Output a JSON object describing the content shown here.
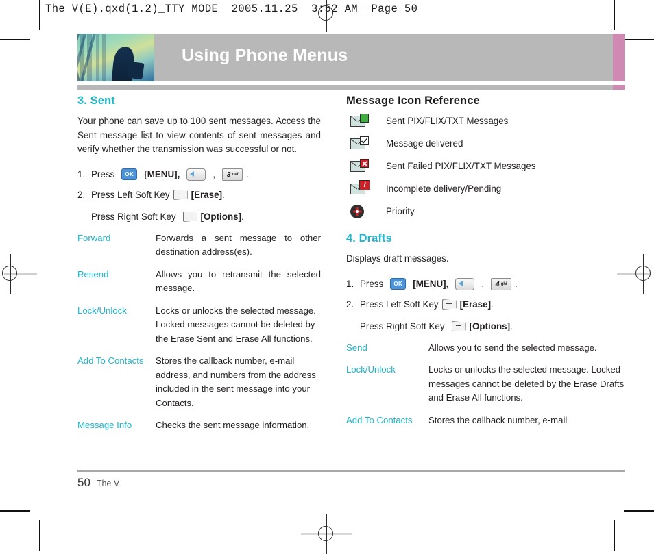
{
  "print_marks": {
    "slug": "The V(E).qxd(1.2)_TTY MODE  2005.11.25  3:52 AM  Page 50"
  },
  "banner": {
    "title": "Using Phone Menus",
    "bar_color": "#b8b8b8",
    "accent_color": "#d089b2"
  },
  "colors": {
    "heading_teal": "#1fb6cd",
    "body_black": "#231f20"
  },
  "left_column": {
    "section": {
      "heading": "3. Sent",
      "intro": "Your phone can save up to 100 sent messages. Access the Sent message list to view contents of sent messages and verify whether the transmission was successful or not."
    },
    "steps": [
      {
        "num": "1.",
        "press_label": "Press",
        "ok_key": "OK",
        "menu_label": "[MENU],",
        "comma": ",",
        "num_key_digit": "3",
        "num_key_letters": "def",
        "period": "."
      },
      {
        "num": "2.",
        "press_label": "Press Left Soft Key",
        "action_label": "[Erase]",
        "period": "."
      }
    ],
    "substep": {
      "press_label": "Press Right Soft Key",
      "action_label": "[Options]",
      "period": "."
    },
    "options": [
      {
        "term": "Forward",
        "desc": "Forwards a sent message to other destination address(es)."
      },
      {
        "term": "Resend",
        "desc": "Allows you to retransmit the selected message."
      },
      {
        "term": "Lock/Unlock",
        "desc": "Locks or unlocks the selected message. Locked messages cannot be deleted by the Erase Sent and Erase All functions."
      },
      {
        "term": "Add To Contacts",
        "desc": "Stores the callback number, e-mail address, and numbers from the address included in the sent message into your Contacts."
      },
      {
        "term": "Message Info",
        "desc": "Checks the sent message information."
      }
    ]
  },
  "right_column": {
    "icon_reference": {
      "heading": "Message Icon Reference",
      "items": [
        {
          "icon": "sent-message-icon",
          "label": "Sent PIX/FLIX/TXT Messages"
        },
        {
          "icon": "message-delivered-icon",
          "label": "Message delivered"
        },
        {
          "icon": "sent-failed-icon",
          "label": "Sent Failed PIX/FLIX/TXT Messages"
        },
        {
          "icon": "incomplete-delivery-icon",
          "label": "Incomplete delivery/Pending"
        },
        {
          "icon": "priority-icon",
          "label": "Priority"
        }
      ]
    },
    "section": {
      "heading": "4. Drafts",
      "intro": "Displays draft messages."
    },
    "steps": [
      {
        "num": "1.",
        "press_label": "Press",
        "ok_key": "OK",
        "menu_label": "[MENU],",
        "comma": ",",
        "num_key_digit": "4",
        "num_key_letters": "ghi",
        "period": "."
      },
      {
        "num": "2.",
        "press_label": "Press Left Soft Key",
        "action_label": "[Erase]",
        "period": "."
      }
    ],
    "substep": {
      "press_label": "Press Right Soft Key",
      "action_label": "[Options]",
      "period": "."
    },
    "options": [
      {
        "term": "Send",
        "desc": "Allows you to send the selected message."
      },
      {
        "term": "Lock/Unlock",
        "desc": "Locks or unlocks the selected message. Locked messages cannot be deleted by the Erase Drafts and Erase All functions."
      },
      {
        "term": "Add To Contacts",
        "desc": "Stores the callback number, e-mail"
      }
    ]
  },
  "footer": {
    "page_number": "50",
    "book_name": "The V"
  }
}
